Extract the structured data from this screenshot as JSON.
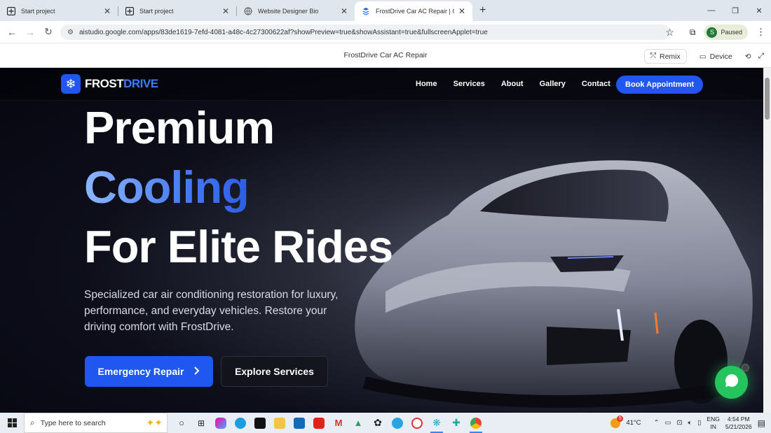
{
  "browser": {
    "tabs": [
      {
        "title": "Start project",
        "active": false
      },
      {
        "title": "Start project",
        "active": false
      },
      {
        "title": "Website Designer Bio",
        "active": false
      },
      {
        "title": "FrostDrive Car AC Repair | Goog",
        "active": true
      }
    ],
    "url": "aistudio.google.com/apps/83de1619-7efd-4081-a48c-4c27300622af?showPreview=true&showAssistant=true&fullscreenApplet=true",
    "profile_initial": "S",
    "profile_status": "Paused"
  },
  "app_header": {
    "title": "FrostDrive Car AC Repair",
    "remix_label": "Remix",
    "device_label": "Device"
  },
  "site": {
    "logo": {
      "part1": "FROST",
      "part2": "DRIVE"
    },
    "nav": [
      "Home",
      "Services",
      "About",
      "Gallery",
      "Contact"
    ],
    "book_label": "Book Appointment",
    "hero": {
      "line1": "Premium",
      "line2": "Cooling",
      "line3": "For Elite Rides",
      "subtitle": "Specialized car air conditioning restoration for luxury, performance, and everyday vehicles. Restore your driving comfort with FrostDrive.",
      "cta_primary": "Emergency Repair",
      "cta_secondary": "Explore Services"
    },
    "colors": {
      "accent": "#1f57f0",
      "chat": "#25c45e"
    }
  },
  "taskbar": {
    "search_placeholder": "Type here to search",
    "weather_badge": "5",
    "temperature": "41°C",
    "lang1": "ENG",
    "lang2": "IN",
    "time": "4:54 PM",
    "date": "5/21/2026"
  }
}
